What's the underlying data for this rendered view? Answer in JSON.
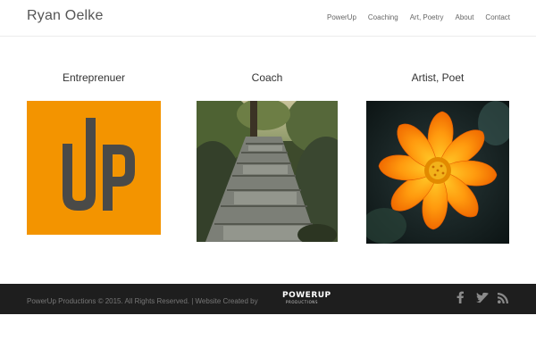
{
  "header": {
    "site_title": "Ryan Oelke",
    "nav": [
      "PowerUp",
      "Coaching",
      "Art, Poetry",
      "About",
      "Contact"
    ]
  },
  "columns": [
    {
      "title": "Entreprenuer",
      "image": "up-logo"
    },
    {
      "title": "Coach",
      "image": "stone-stairs-garden-photo"
    },
    {
      "title": "Artist, Poet",
      "image": "orange-flower-photo"
    }
  ],
  "logo": {
    "text": "UP",
    "bg": "#F39400",
    "fg": "#4a4a48"
  },
  "footer": {
    "text": "PowerUp Productions © 2015. All Rights Reserved. | Website Created by",
    "logo_main": "POWERUP",
    "logo_sub": "PRODUCTIONS",
    "social": [
      "facebook-icon",
      "twitter-icon",
      "rss-icon"
    ]
  },
  "colors": {
    "footer_bg": "#1e1e1e",
    "accent": "#F39400"
  }
}
